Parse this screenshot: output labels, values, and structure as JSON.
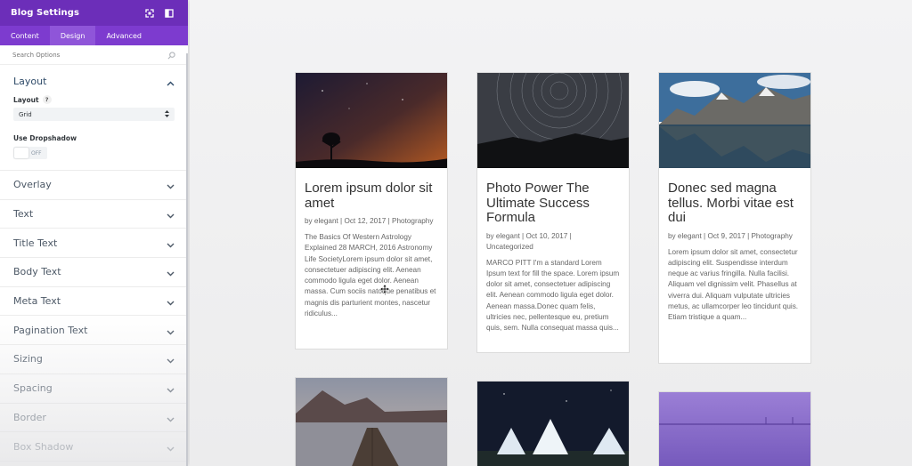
{
  "panel": {
    "title": "Blog Settings",
    "tabs": [
      {
        "label": "Content"
      },
      {
        "label": "Design"
      },
      {
        "label": "Advanced"
      }
    ],
    "search_placeholder": "Search Options",
    "layout_section": {
      "title": "Layout",
      "layout_label": "Layout",
      "help": "?",
      "layout_value": "Grid",
      "dropshadow_label": "Use Dropshadow",
      "dropshadow_state": "OFF"
    },
    "groups": [
      "Overlay",
      "Text",
      "Title Text",
      "Body Text",
      "Meta Text",
      "Pagination Text",
      "Sizing",
      "Spacing",
      "Border",
      "Box Shadow"
    ]
  },
  "posts": [
    {
      "title": "Lorem ipsum dolor sit amet",
      "meta": "by elegant | Oct 12, 2017 | Photography",
      "excerpt": "The Basics Of Western Astrology Explained 28 MARCH, 2016 Astronomy Life SocietyLorem ipsum dolor sit amet, consectetuer adipiscing elit. Aenean commodo ligula eget dolor. Aenean massa. Cum sociis natoque penatibus et magnis dis parturient montes, nascetur ridiculus..."
    },
    {
      "title": "Photo Power The Ultimate Success Formula",
      "meta": "by elegant | Oct 10, 2017 | Uncategorized",
      "excerpt": "MARCO PITT I'm a standard Lorem Ipsum text for fill the space. Lorem ipsum dolor sit amet, consectetuer adipiscing elit. Aenean commodo ligula eget dolor. Aenean massa.Donec quam felis, ultricies nec, pellentesque eu, pretium quis, sem. Nulla consequat massa quis..."
    },
    {
      "title": "Donec sed magna tellus. Morbi vitae est dui",
      "meta": "by elegant | Oct 9, 2017 | Photography",
      "excerpt": "Lorem ipsum dolor sit amet, consectetur adipiscing elit. Suspendisse interdum neque ac varius fringilla. Nulla facilisi. Aliquam vel dignissim velit. Phasellus at viverra dui. Aliquam vulputate ultricies metus, ac ullamcorper leo tincidunt quis. Etiam tristique a quam..."
    }
  ],
  "colors": {
    "header": "#6c2eb9",
    "tabs": "#7d3bcf",
    "active_tab": "#8f55d9",
    "card_title": "#333333",
    "card_text": "#666666"
  },
  "icons": {
    "expand": "expand-icon",
    "sidebar_toggle": "sidebar-toggle-icon",
    "search": "search-icon",
    "chevron_up": "chevron-up-icon",
    "chevron_down": "chevron-down-icon",
    "select_arrows": "select-arrows-icon",
    "move_cursor": "move-cursor-icon"
  }
}
